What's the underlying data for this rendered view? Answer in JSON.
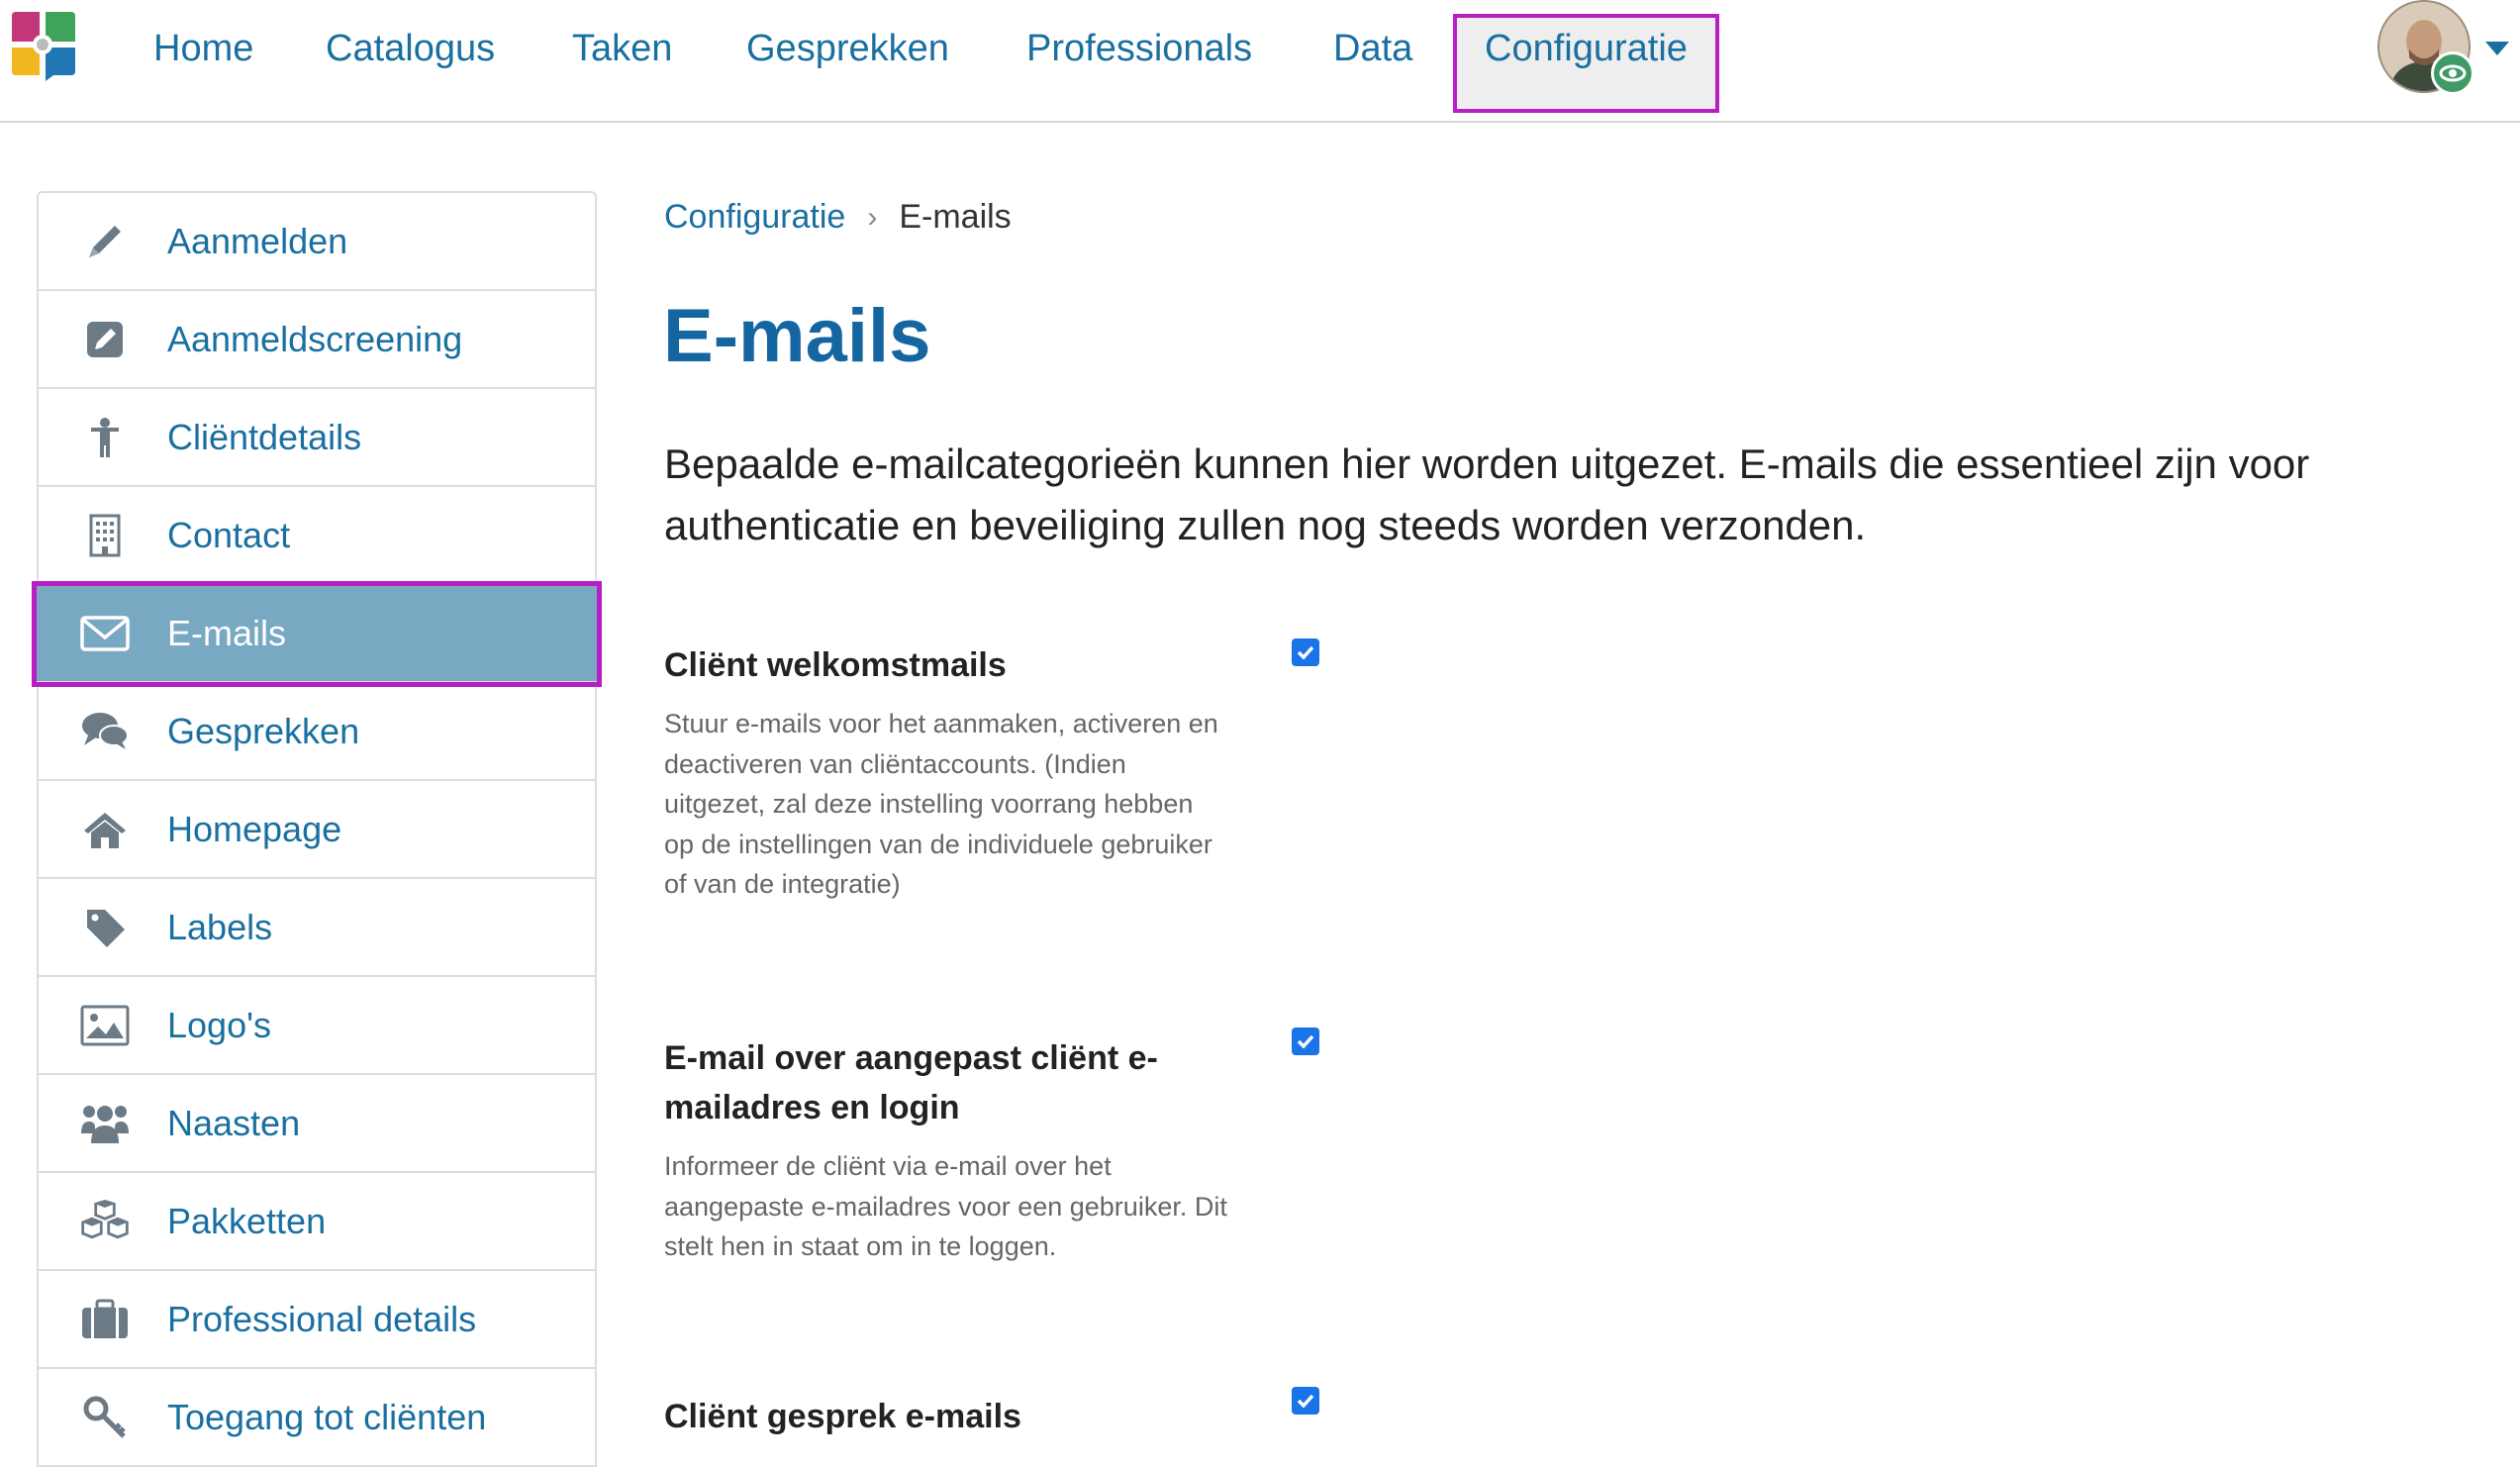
{
  "nav": {
    "items": [
      {
        "label": "Home"
      },
      {
        "label": "Catalogus"
      },
      {
        "label": "Taken"
      },
      {
        "label": "Gesprekken"
      },
      {
        "label": "Professionals"
      },
      {
        "label": "Data"
      },
      {
        "label": "Configuratie",
        "active": true
      }
    ]
  },
  "sidebar": {
    "items": [
      {
        "label": "Aanmelden",
        "icon": "pencil-icon"
      },
      {
        "label": "Aanmeldscreening",
        "icon": "edit-square-icon"
      },
      {
        "label": "Cliëntdetails",
        "icon": "person-icon"
      },
      {
        "label": "Contact",
        "icon": "building-icon"
      },
      {
        "label": "E-mails",
        "icon": "envelope-icon",
        "active": true
      },
      {
        "label": "Gesprekken",
        "icon": "comments-icon"
      },
      {
        "label": "Homepage",
        "icon": "home-icon"
      },
      {
        "label": "Labels",
        "icon": "tag-icon"
      },
      {
        "label": "Logo's",
        "icon": "image-icon"
      },
      {
        "label": "Naasten",
        "icon": "users-icon"
      },
      {
        "label": "Pakketten",
        "icon": "cubes-icon"
      },
      {
        "label": "Professional details",
        "icon": "briefcase-icon"
      },
      {
        "label": "Toegang tot cliënten",
        "icon": "key-icon"
      }
    ]
  },
  "breadcrumb": {
    "parent": "Configuratie",
    "separator": "›",
    "current": "E-mails"
  },
  "page": {
    "title": "E-mails",
    "intro": "Bepaalde e-mailcategorieën kunnen hier worden uitgezet. E-mails die essentieel zijn voor authenticatie en beveiliging zullen nog steeds worden verzonden."
  },
  "settings": [
    {
      "title": "Cliënt welkomstmails",
      "description": "Stuur e-mails voor het aanmaken, activeren en deactiveren van cliëntaccounts. (Indien uitgezet, zal deze instelling voorrang hebben op de instellingen van de individuele gebruiker of van de integratie)",
      "checked": true
    },
    {
      "title": "E-mail over aangepast cliënt e-mailadres en login",
      "description": "Informeer de cliënt via e-mail over het aangepaste e-mailadres voor een gebruiker. Dit stelt hen in staat om in te loggen.",
      "checked": true
    },
    {
      "title": "Cliënt gesprek e-mails",
      "description": "",
      "checked": true
    }
  ],
  "colors": {
    "brand": "#1465a0",
    "link": "#1a6fa1",
    "active_sidebar": "#78a8c2",
    "highlight": "#b81fc2",
    "checkbox": "#1a73e8"
  }
}
